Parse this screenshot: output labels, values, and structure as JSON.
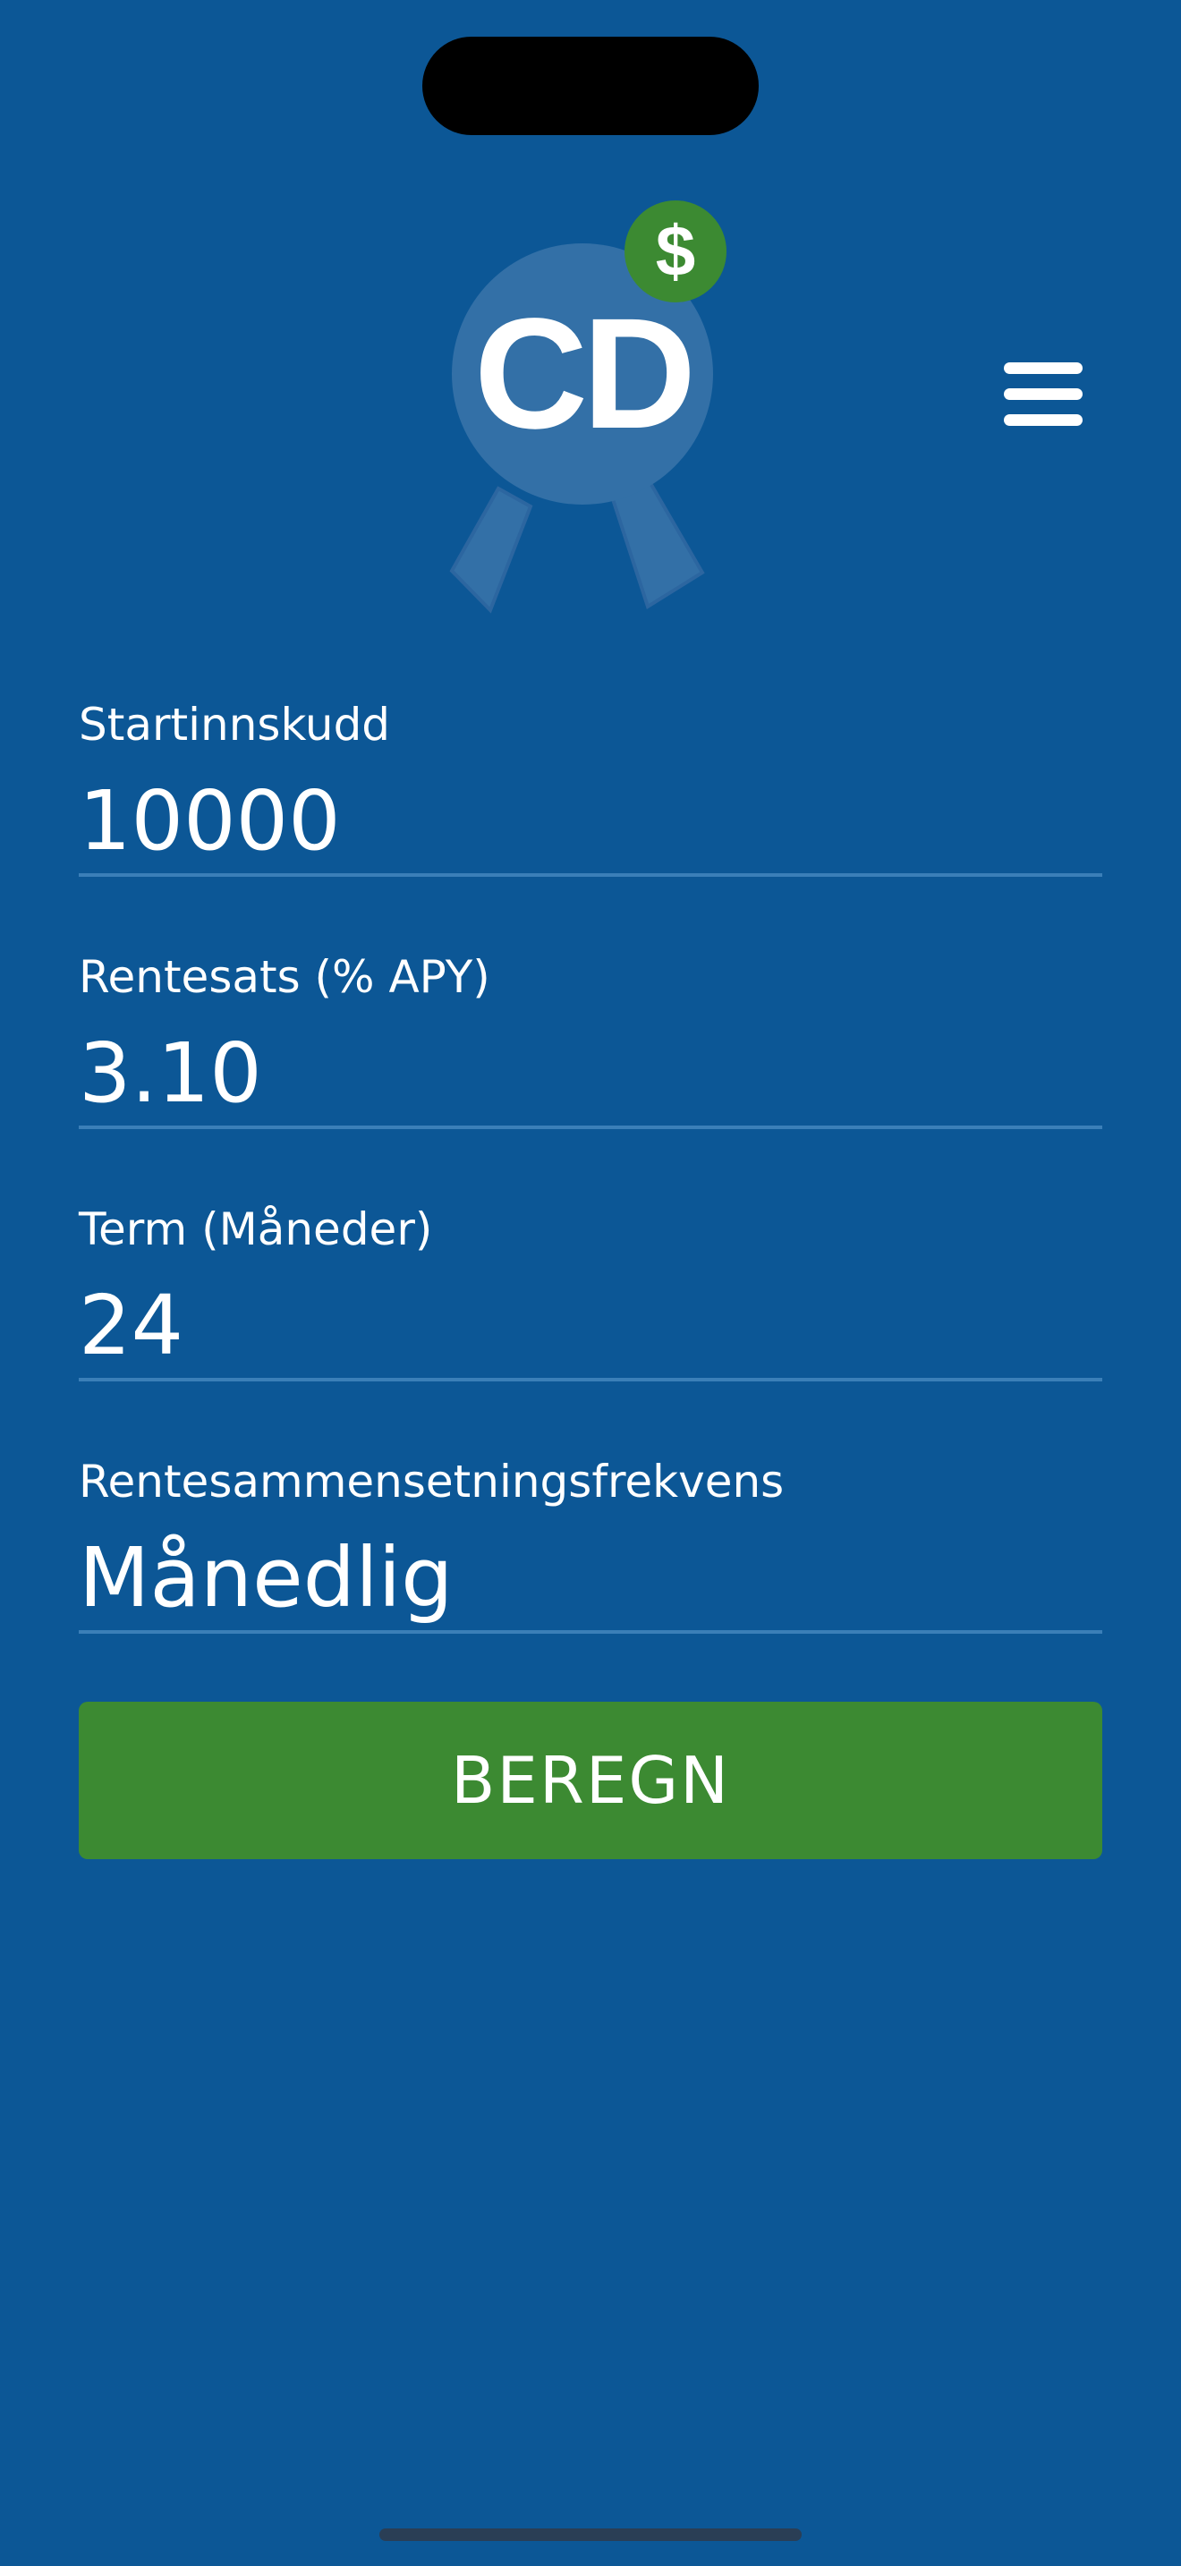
{
  "colors": {
    "background": "#0c5796",
    "accent_green": "#3c8a32",
    "badge_blue": "#3370a7",
    "divider": "#3b7fb8"
  },
  "logo": {
    "text": "CD",
    "badge_symbol": "$",
    "icon": "award-ribbon-icon"
  },
  "menu": {
    "icon": "hamburger-menu-icon"
  },
  "form": {
    "initial_deposit": {
      "label": "Startinnskudd",
      "value": "10000"
    },
    "interest_rate": {
      "label": "Rentesats (% APY)",
      "value": "3.10"
    },
    "term": {
      "label": "Term (Måneder)",
      "value": "24"
    },
    "compounding": {
      "label": "Rentesammensetningsfrekvens",
      "value": "Månedlig"
    }
  },
  "actions": {
    "calculate_label": "BEREGN"
  }
}
